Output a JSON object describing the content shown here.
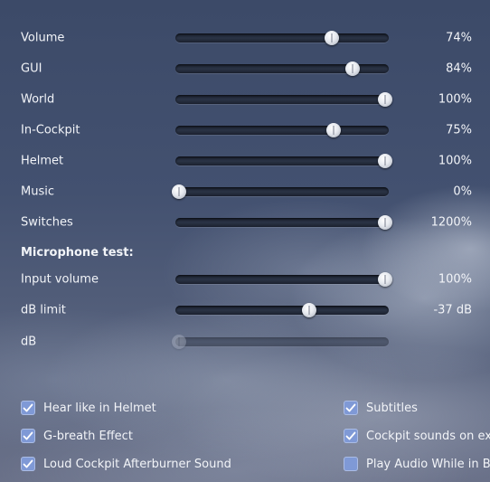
{
  "sliders": [
    {
      "label": "Volume",
      "value_text": "74%",
      "level": 0.74,
      "disabled": false
    },
    {
      "label": "GUI",
      "value_text": "84%",
      "level": 0.84,
      "disabled": false
    },
    {
      "label": "World",
      "value_text": "100%",
      "level": 1.0,
      "disabled": false
    },
    {
      "label": "In-Cockpit",
      "value_text": "75%",
      "level": 0.75,
      "disabled": false
    },
    {
      "label": "Helmet",
      "value_text": "100%",
      "level": 1.0,
      "disabled": false
    },
    {
      "label": "Music",
      "value_text": "0%",
      "level": 0.0,
      "disabled": false
    },
    {
      "label": "Switches",
      "value_text": "1200%",
      "level": 1.0,
      "disabled": false
    }
  ],
  "microphone": {
    "title": "Microphone test:",
    "sliders": [
      {
        "label": "Input volume",
        "value_text": "100%",
        "level": 1.0,
        "disabled": false
      },
      {
        "label": "dB limit",
        "value_text": "-37 dB",
        "level": 0.63,
        "disabled": false
      },
      {
        "label": "dB",
        "value_text": "",
        "level": 0.0,
        "disabled": true
      }
    ]
  },
  "checkboxes_left": [
    {
      "label": "Hear like in Helmet",
      "checked": true
    },
    {
      "label": "G-breath Effect",
      "checked": true
    },
    {
      "label": "Loud Cockpit Afterburner Sound",
      "checked": true
    }
  ],
  "checkboxes_right": [
    {
      "label": "Subtitles",
      "checked": true
    },
    {
      "label": "Cockpit sounds on exter",
      "checked": true
    },
    {
      "label": "Play Audio While in Back",
      "checked": false
    }
  ],
  "colors": {
    "accent": "#7f99d6",
    "text": "#f2f4f8",
    "track": "#232a3a"
  }
}
